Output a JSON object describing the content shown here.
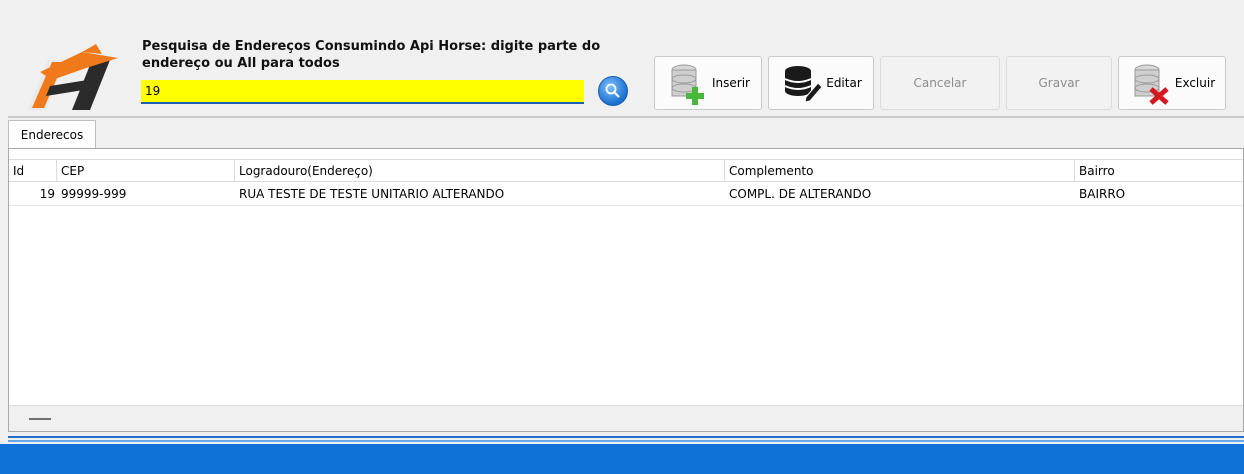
{
  "search": {
    "label": "Pesquisa de Endereços Consumindo Api Horse: digite parte do endereço ou All para todos",
    "value": "19"
  },
  "toolbar": {
    "inserir": "Inserir",
    "editar": "Editar",
    "cancelar": "Cancelar",
    "gravar": "Gravar",
    "excluir": "Excluir"
  },
  "tabs": [
    {
      "label": "Enderecos"
    }
  ],
  "grid": {
    "columns": [
      "Id",
      "CEP",
      "Logradouro(Endereço)",
      "Complemento",
      "Bairro"
    ],
    "rows": [
      {
        "id": "19",
        "cep": "99999-999",
        "logradouro": "RUA TESTE DE TESTE UNITARIO ALTERANDO",
        "complemento": "COMPL. DE ALTERANDO",
        "bairro": "BAIRRO"
      }
    ]
  },
  "colors": {
    "search_bg": "#ffff00",
    "accent": "#0f72d8",
    "logo_orange": "#f07a1a"
  },
  "icons": [
    "horse-logo-icon",
    "search-icon",
    "database-add-icon",
    "database-edit-icon",
    "database-delete-icon"
  ]
}
